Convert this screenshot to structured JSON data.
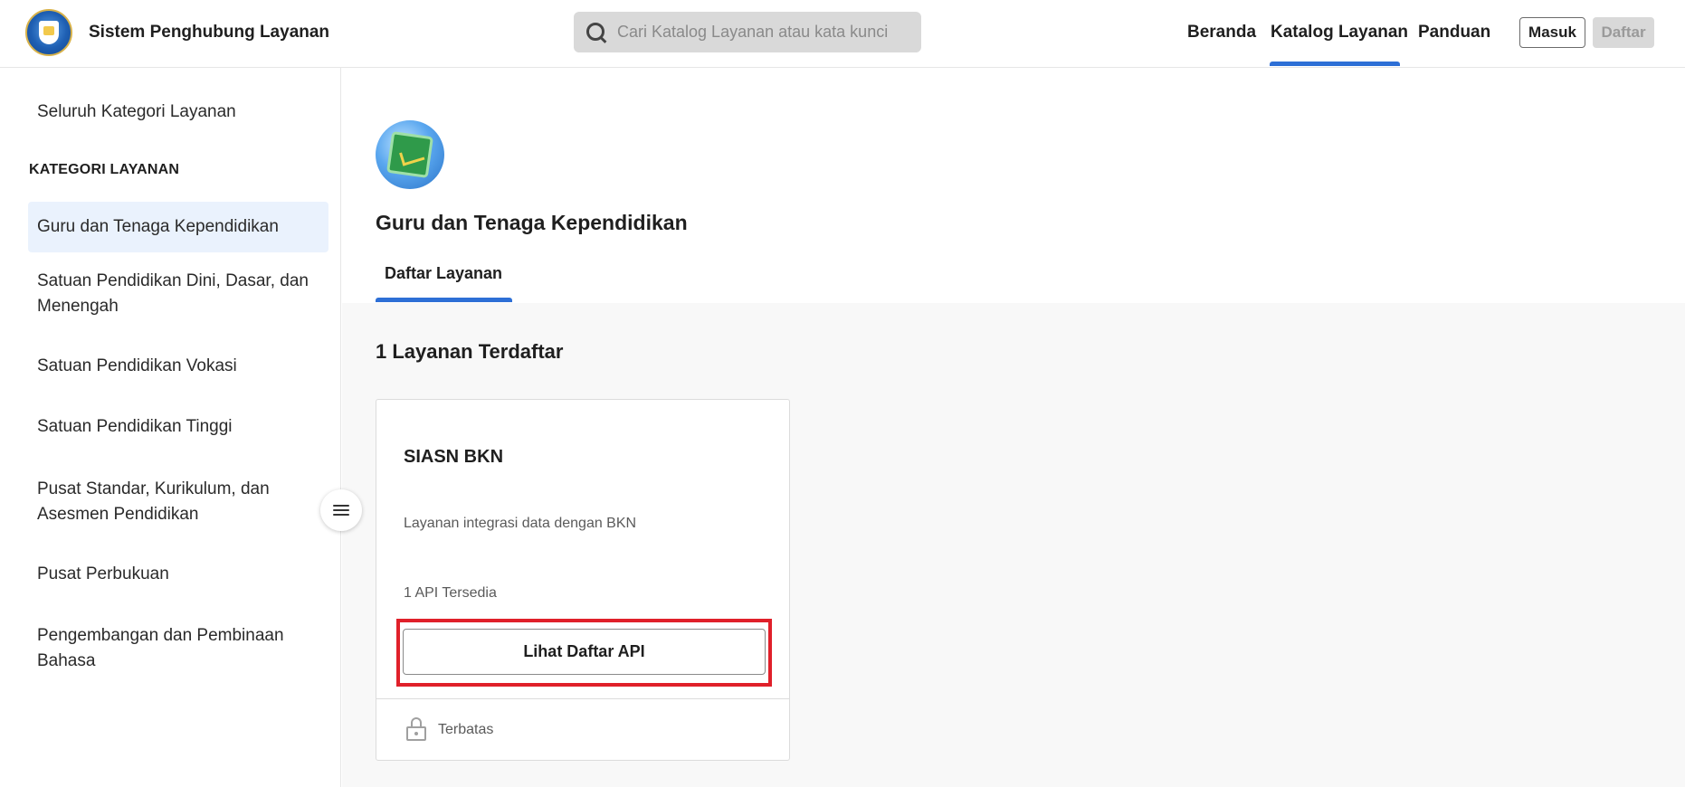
{
  "header": {
    "app_title": "Sistem Penghubung Layanan",
    "search_placeholder": "Cari Katalog Layanan atau kata kunci",
    "nav": {
      "home": "Beranda",
      "catalog": "Katalog Layanan",
      "guide": "Panduan"
    },
    "login_label": "Masuk",
    "register_label": "Daftar"
  },
  "sidebar": {
    "all_categories": "Seluruh Kategori Layanan",
    "heading": "KATEGORI LAYANAN",
    "items": [
      {
        "label": "Guru dan Tenaga Kependidikan",
        "active": true
      },
      {
        "label": "Satuan Pendidikan Dini, Dasar, dan Menengah",
        "active": false
      },
      {
        "label": "Satuan Pendidikan Vokasi",
        "active": false
      },
      {
        "label": "Satuan Pendidikan Tinggi",
        "active": false
      },
      {
        "label": "Pusat Standar, Kurikulum, dan Asesmen Pendidikan",
        "active": false
      },
      {
        "label": "Pusat Perbukuan",
        "active": false
      },
      {
        "label": "Pengembangan dan Pembinaan Bahasa",
        "active": false
      }
    ]
  },
  "main": {
    "category_title": "Guru dan Tenaga Kependidikan",
    "tab_label": "Daftar Layanan",
    "count_label": "1 Layanan Terdaftar",
    "cards": [
      {
        "name": "SIASN BKN",
        "description": "Layanan integrasi data dengan BKN",
        "api_count": "1 API Tersedia",
        "button_label": "Lihat Daftar API",
        "access": "Terbatas"
      }
    ]
  },
  "colors": {
    "accent": "#2d6fd6",
    "highlight": "#e0202a",
    "active_bg": "#eaf2fd"
  },
  "icons": [
    "logo-icon",
    "search-icon",
    "hamburger-icon",
    "category-icon",
    "lock-icon"
  ]
}
